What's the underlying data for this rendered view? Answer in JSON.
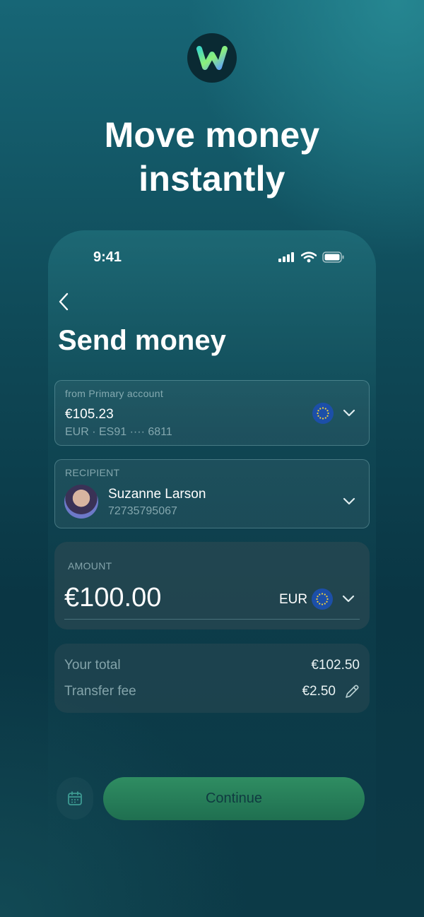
{
  "headline": {
    "line1": "Move money",
    "line2": "instantly"
  },
  "status_bar": {
    "time": "9:41"
  },
  "screen": {
    "title": "Send money"
  },
  "from_account": {
    "label": "from Primary account",
    "balance": "€105.23",
    "details": "EUR · ES91 ···· 6811",
    "currency_icon": "eu-flag-icon"
  },
  "recipient": {
    "label": "RECIPIENT",
    "name": "Suzanne Larson",
    "number": "72735795067"
  },
  "amount": {
    "label": "AMOUNT",
    "value": "€100.00",
    "currency": "EUR"
  },
  "summary": {
    "total_label": "Your total",
    "total_value": "€102.50",
    "fee_label": "Transfer fee",
    "fee_value": "€2.50"
  },
  "actions": {
    "continue_label": "Continue"
  },
  "colors": {
    "accent_green": "#2f8d62",
    "eu_blue": "#1c4fa8",
    "background_teal": "#0f4a58"
  }
}
